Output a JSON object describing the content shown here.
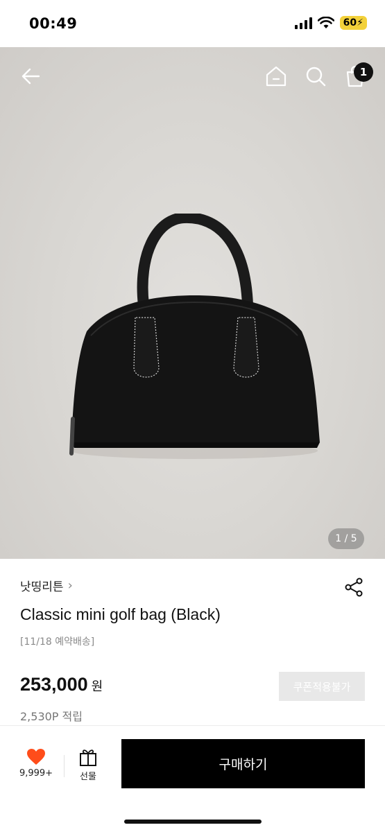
{
  "status_bar": {
    "time": "00:49",
    "battery_level": "60",
    "battery_color": "#f3d13a"
  },
  "hero": {
    "image_counter": "1 / 5",
    "cart_badge_count": "1"
  },
  "product": {
    "brand": "낫띵리튼",
    "name": "Classic mini golf bag (Black)",
    "delivery_note": "[11/18 예약배송]",
    "price": "253,000",
    "price_unit": "원",
    "points": "2,530P 적립",
    "coupon_label": "쿠폰적용불가"
  },
  "bottom_bar": {
    "like_count": "9,999+",
    "gift_label": "선물",
    "buy_label": "구매하기",
    "like_color": "#ff4d1a"
  }
}
